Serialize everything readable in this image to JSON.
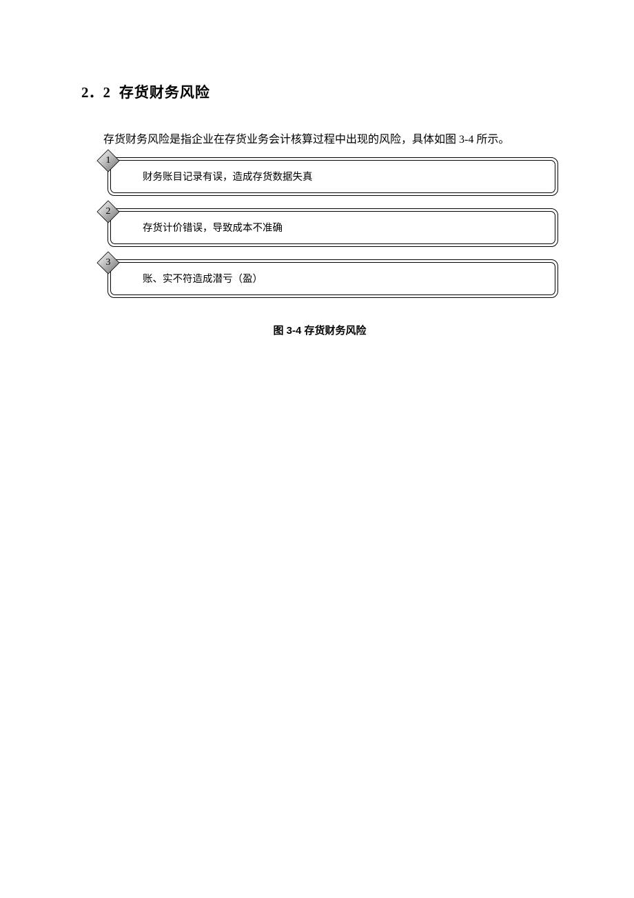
{
  "heading": {
    "number": "2．2",
    "title": "存货财务风险"
  },
  "intro": "存货财务风险是指企业在存货业务会计核算过程中出现的风险，具体如图 3-4 所示。",
  "risks": [
    {
      "num": "1",
      "text": "财务账目记录有误，造成存货数据失真"
    },
    {
      "num": "2",
      "text": "存货计价错误，导致成本不准确"
    },
    {
      "num": "3",
      "text": "账、实不符造成潜亏（盈）"
    }
  ],
  "caption": "图 3-4  存货财务风险"
}
